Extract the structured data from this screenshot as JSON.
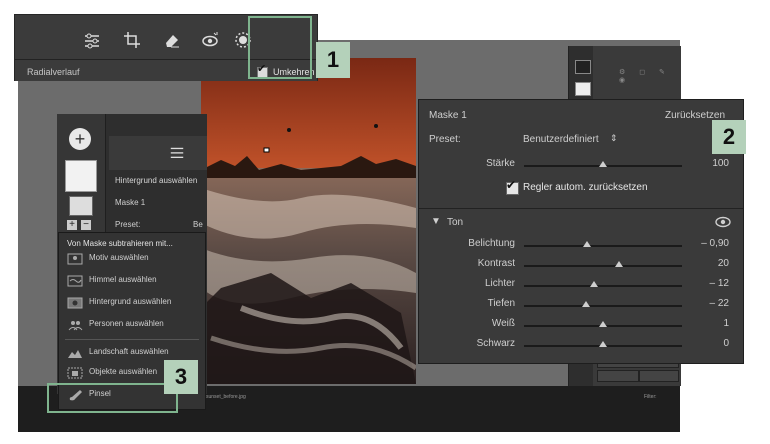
{
  "toolbar": {
    "icons": [
      "sliders-icon",
      "crop-icon",
      "eraser-icon",
      "redeye-icon",
      "masking-icon"
    ],
    "tool_label": "Radialverlauf",
    "invert_label": "Umkehren",
    "invert_checked": true
  },
  "badges": {
    "one": "1",
    "two": "2",
    "three": "3"
  },
  "mask_panel": {
    "background_label": "Hintergrund auswählen",
    "mask_label": "Maske 1",
    "preset_label": "Preset:",
    "preset_value_truncated": "Be"
  },
  "context_menu": {
    "heading": "Von Maske subtrahieren mit...",
    "items": [
      {
        "label": "Motiv auswählen",
        "icon": "subject-icon"
      },
      {
        "label": "Himmel auswählen",
        "icon": "sky-icon"
      },
      {
        "label": "Hintergrund auswählen",
        "icon": "background-icon"
      },
      {
        "label": "Personen auswählen",
        "icon": "people-icon"
      },
      {
        "label": "Landschaft auswählen",
        "icon": "landscape-icon"
      },
      {
        "label": "Objekte auswählen",
        "icon": "objects-icon"
      },
      {
        "label": "Pinsel",
        "icon": "brush-icon"
      }
    ]
  },
  "settings": {
    "mask_title": "Maske 1",
    "reset_label": "Zurücksetzen",
    "preset_label": "Preset:",
    "preset_value": "Benutzerdefiniert",
    "strength_label": "Stärke",
    "strength_value": "100",
    "auto_reset_label": "Regler autom. zurücksetzen",
    "auto_reset_checked": true,
    "section_label": "Ton",
    "sliders": [
      {
        "label": "Belichtung",
        "value": "– 0,90",
        "position": 0.4
      },
      {
        "label": "Kontrast",
        "value": "20",
        "position": 0.6
      },
      {
        "label": "Lichter",
        "value": "– 12",
        "position": 0.44
      },
      {
        "label": "Tiefen",
        "value": "– 22",
        "position": 0.39
      },
      {
        "label": "Weiß",
        "value": "1",
        "position": 0.5
      },
      {
        "label": "Schwarz",
        "value": "0",
        "position": 0.5
      }
    ]
  },
  "filmstrip": {
    "filename": "sunset_before.jpg",
    "filter_label": "Filter:"
  },
  "colors": {
    "highlight": "#7fb48e",
    "badge": "#b4d1ba"
  }
}
